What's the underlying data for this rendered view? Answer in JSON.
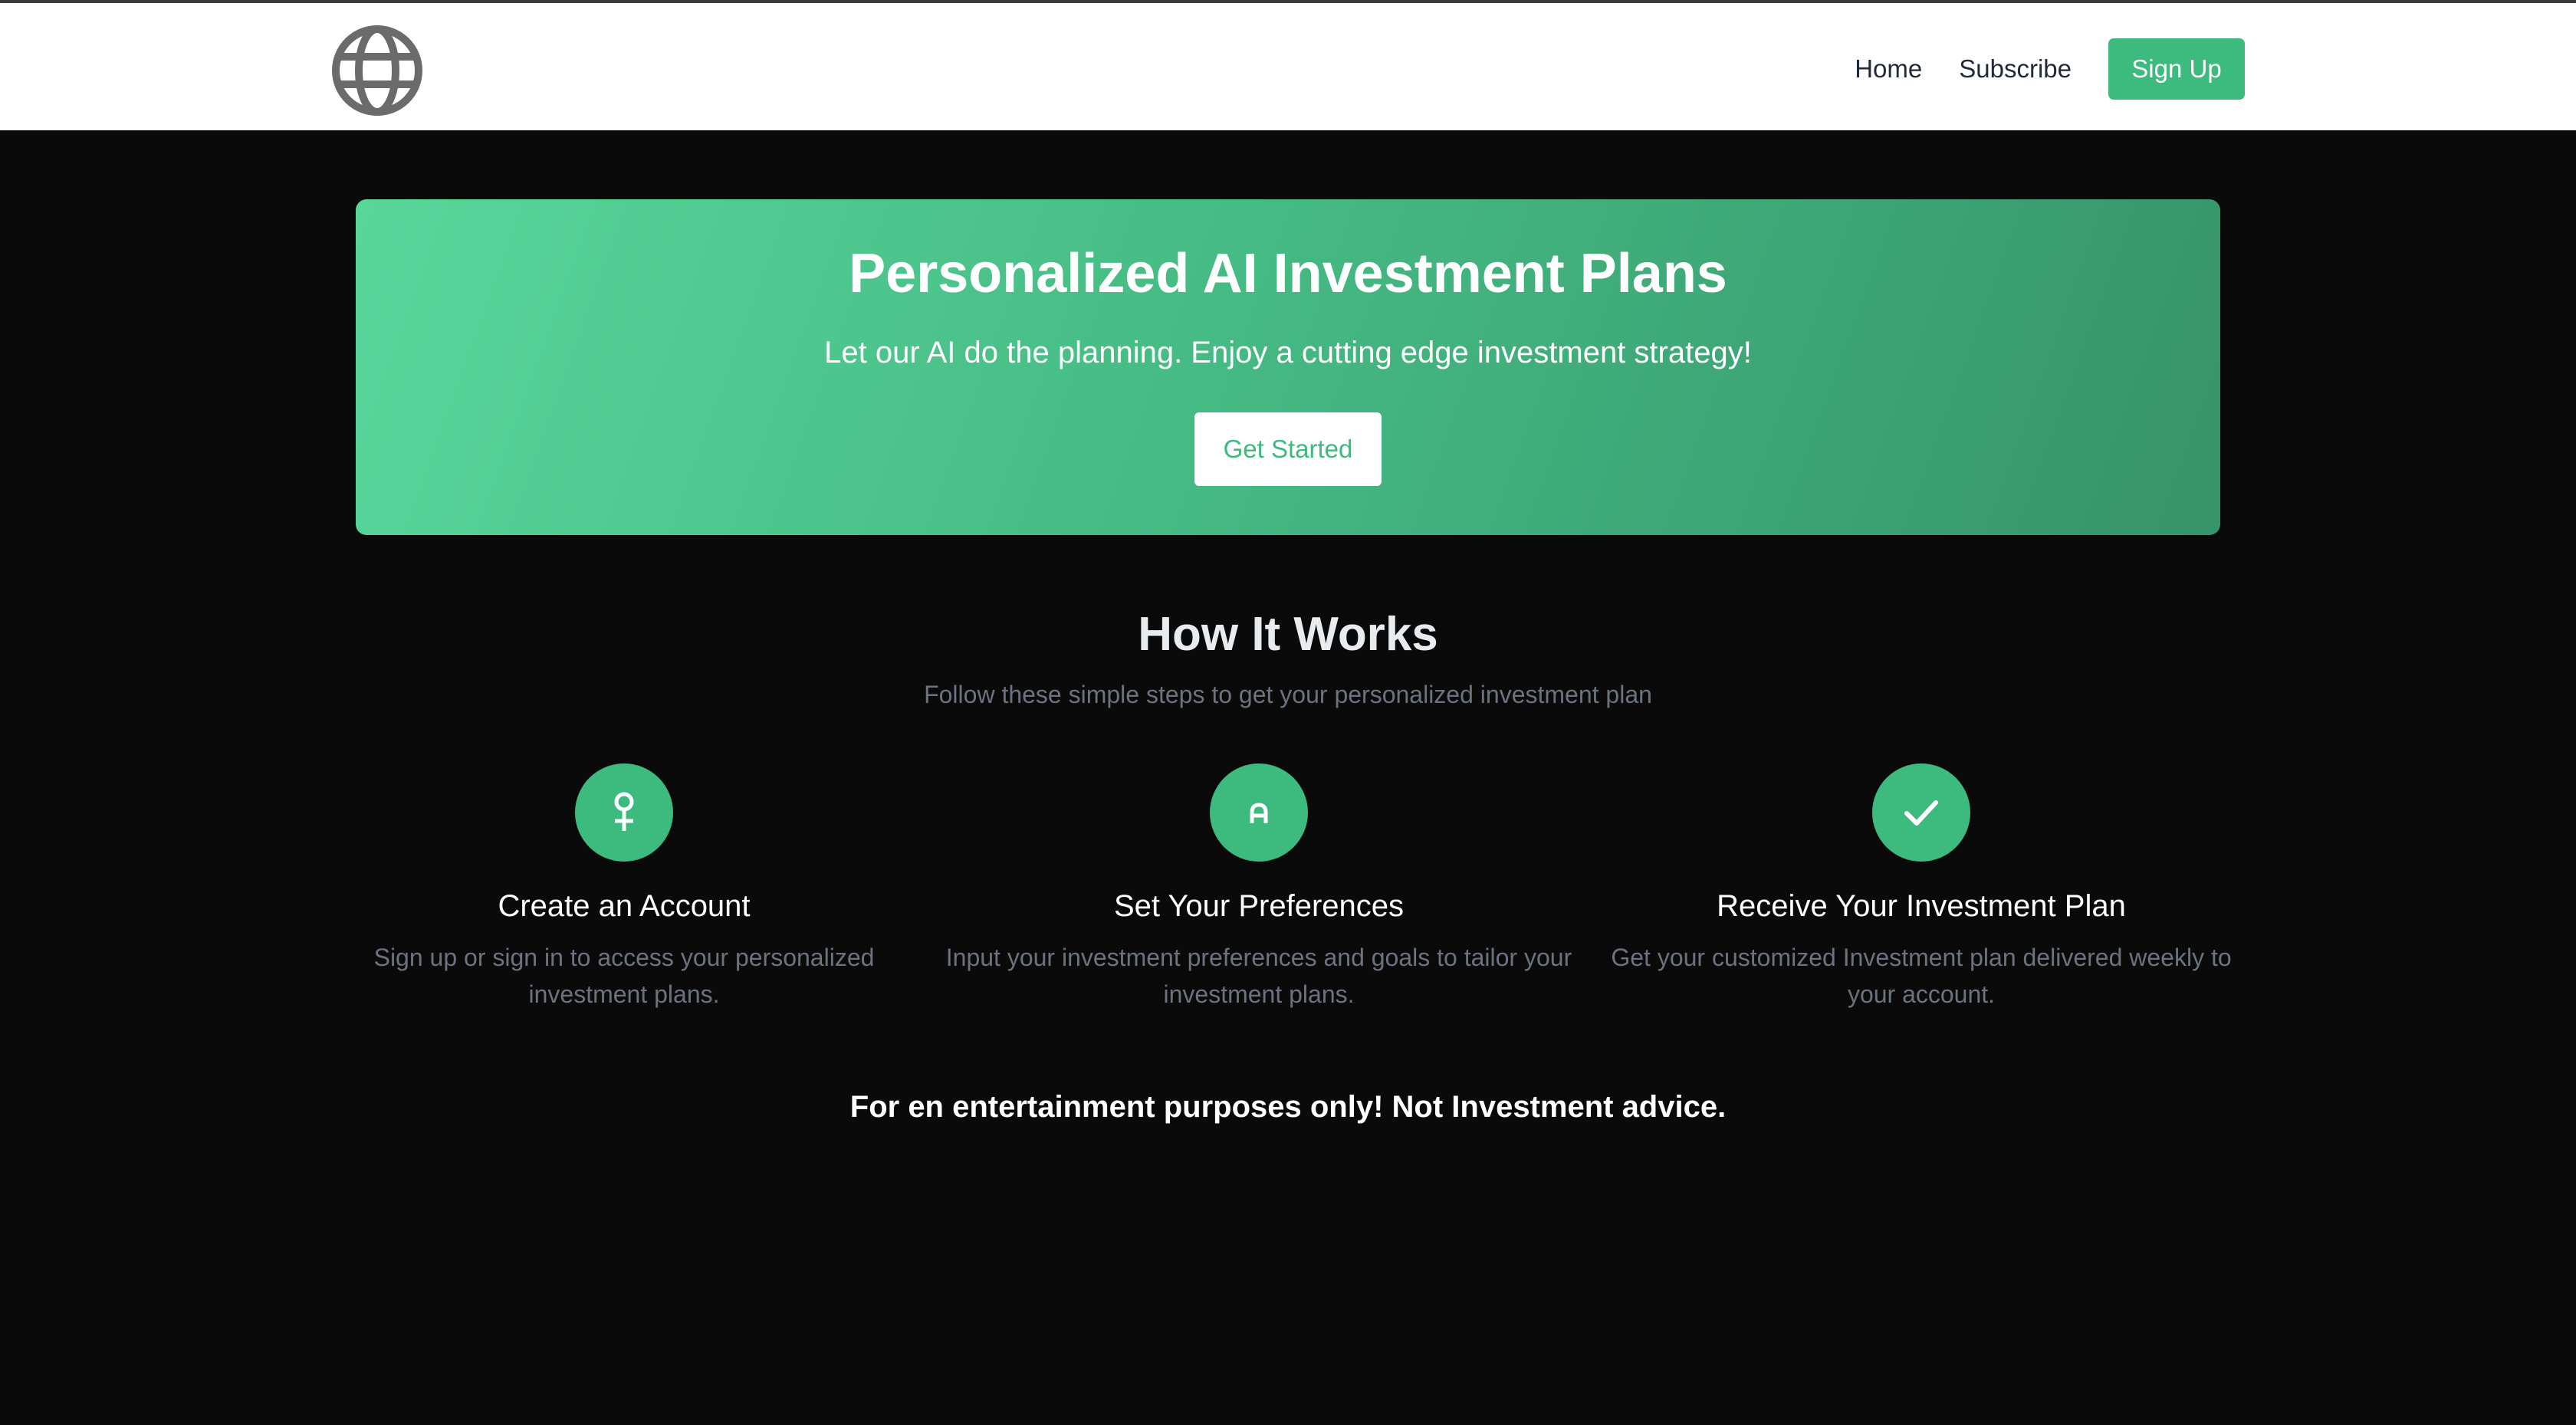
{
  "header": {
    "logo_icon": "globe-icon",
    "nav": {
      "home_label": "Home",
      "subscribe_label": "Subscribe",
      "signup_label": "Sign Up"
    }
  },
  "hero": {
    "title": "Personalized AI Investment Plans",
    "subtitle": "Let our AI do the planning. Enjoy a cutting edge investment strategy!",
    "cta_label": "Get Started"
  },
  "how_it_works": {
    "title": "How It Works",
    "subtitle": "Follow these simple steps to get your personalized investment plan",
    "steps": [
      {
        "icon": "user-icon",
        "title": "Create an Account",
        "description": "Sign up or sign in to access your personalized investment plans."
      },
      {
        "icon": "preferences-icon",
        "title": "Set Your Preferences",
        "description": "Input your investment preferences and goals to tailor your investment plans."
      },
      {
        "icon": "check-icon",
        "title": "Receive Your Investment Plan",
        "description": "Get your customized Investment plan delivered weekly to your account."
      }
    ]
  },
  "disclaimer": "For en entertainment purposes only! Not Investment advice.",
  "colors": {
    "accent": "#3dba7e",
    "background": "#0a0a0a",
    "muted_text": "#6b7380"
  }
}
